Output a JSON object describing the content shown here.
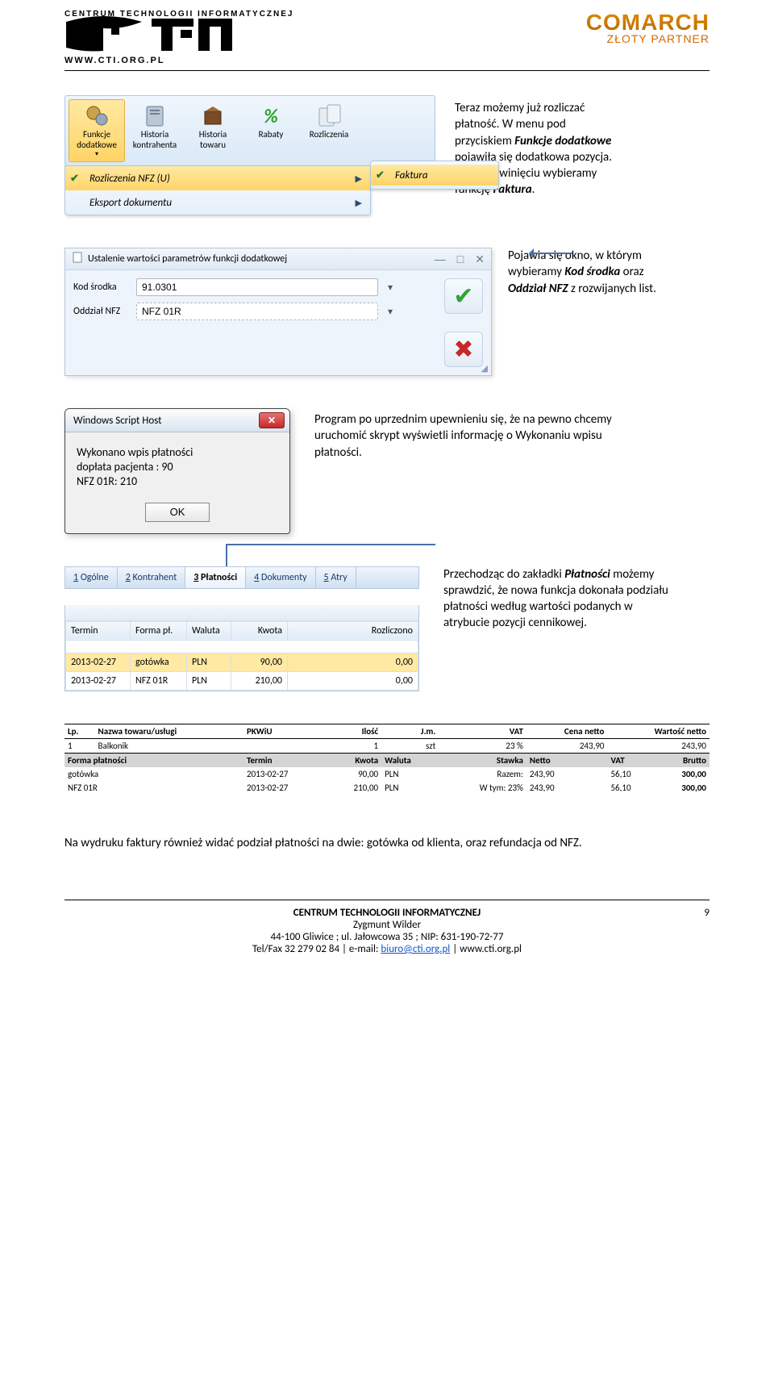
{
  "header": {
    "cti_top": "CENTRUM TECHNOLOGII INFORMATYCZNEJ",
    "cti_url": "WWW.CTI.ORG.PL",
    "comarch": "COMARCH",
    "comarch_sub": "ZŁOTY PARTNER"
  },
  "p1_l1": "Teraz możemy już rozliczać",
  "p1_l2": "płatność. W menu pod",
  "p1_l3a": "przyciskiem ",
  "p1_l3b": "Funkcje dodatkowe",
  "p1_l4": "pojawiła się dodatkowa pozycja.",
  "p1_l5": "Po jej rozwinięciu wybieramy",
  "p1_l6a": "funkcję ",
  "p1_l6b": "Faktura",
  "p1_l6c": ".",
  "ribbon": {
    "items": [
      {
        "label": "Funkcje dodatkowe"
      },
      {
        "label": "Historia kontrahenta"
      },
      {
        "label": "Historia towaru"
      },
      {
        "label": "Rabaty"
      },
      {
        "label": "Rozliczenia"
      }
    ],
    "menu": {
      "item1": "Rozliczenia NFZ (U)",
      "item2": "Eksport dokumentu",
      "sub1": "Faktura"
    }
  },
  "p2_l1": "Pojawia się okno, w którym",
  "p2_l2a": "wybieramy ",
  "p2_l2b": "Kod środka",
  "p2_l2c": " oraz",
  "p2_l3a": "Oddział NFZ",
  "p2_l3b": " z rozwijanych list.",
  "dlg": {
    "title": "Ustalenie wartości parametrów funkcji dodatkowej",
    "field1_label": "Kod środka",
    "field1_value": "91.0301",
    "field2_label": "Oddział NFZ",
    "field2_value": "NFZ 01R"
  },
  "p3_l1": "Program po uprzednim upewnieniu się, że na pewno chcemy",
  "p3_l2": "uruchomić skrypt wyświetli informację o Wykonaniu wpisu",
  "p3_l3": "płatności.",
  "wsh": {
    "title": "Windows Script Host",
    "msg_l1": "Wykonano wpis płatności",
    "msg_l2": "dopłata pacjenta : 90",
    "msg_l3": "NFZ 01R: 210",
    "ok": "OK"
  },
  "p4_l1a": "Przechodząc do zakładki ",
  "p4_l1b": "Płatności",
  "p4_l1c": " możemy",
  "p4_l2": "sprawdzić, że nowa funkcja dokonała podziału",
  "p4_l3": "płatności według wartości podanych w",
  "p4_l4": "atrybucie pozycji cennikowej.",
  "tabs": {
    "t1": "1 Ogólne",
    "t2": "2 Kontrahent",
    "t3": "3 Płatności",
    "t4": "4 Dokumenty",
    "t5": "5 Atry"
  },
  "grid": {
    "h1": "Termin",
    "h2": "Forma pł.",
    "h3": "Waluta",
    "h4": "Kwota",
    "h5": "Rozliczono",
    "r1": {
      "c1": "2013-02-27",
      "c2": "gotówka",
      "c3": "PLN",
      "c4": "90,00",
      "c5": "0,00"
    },
    "r2": {
      "c1": "2013-02-27",
      "c2": "NFZ 01R",
      "c3": "PLN",
      "c4": "210,00",
      "c5": "0,00"
    }
  },
  "print": {
    "h_lp": "Lp.",
    "h_name": "Nazwa towaru/usługi",
    "h_pkwiu": "PKWiU",
    "h_qty": "Ilość",
    "h_jm": "J.m.",
    "h_vat": "VAT",
    "h_cena": "Cena netto",
    "h_wart": "Wartość netto",
    "r1_lp": "1",
    "r1_name": "Balkonik",
    "r1_qty": "1",
    "r1_jm": "szt",
    "r1_vat": "23 %",
    "r1_cena": "243,90",
    "r1_wart": "243,90",
    "g_forma": "Forma płatności",
    "g_termin": "Termin",
    "g_kwota": "Kwota",
    "g_waluta": "Waluta",
    "g_stawka": "Stawka",
    "g_netto": "Netto",
    "g_vat": "VAT",
    "g_brutto": "Brutto",
    "p1_forma": "gotówka",
    "p1_termin": "2013-02-27",
    "p1_kwota": "90,00",
    "p1_wal": "PLN",
    "p1_lbl": "Razem:",
    "p1_netto": "243,90",
    "p1_vat": "56,10",
    "p1_brutto": "300,00",
    "p2_forma": "NFZ 01R",
    "p2_termin": "2013-02-27",
    "p2_kwota": "210,00",
    "p2_wal": "PLN",
    "p2_lbl": "W tym:",
    "p2_stawka": "23%",
    "p2_netto": "243,90",
    "p2_vat": "56,10",
    "p2_brutto": "300,00"
  },
  "p5": "Na wydruku faktury również widać podział płatności na dwie: gotówka od klienta,ẇ oraz refundacja od NFZ.",
  "p5_fixed": "Na wydruku faktury również widać podział płatności na dwie: gotówka od klienta, oraz refundacja od NFZ.",
  "footer": {
    "l1": "CENTRUM TECHNOLOGII INFORMATYCZNEJ",
    "l2": "Zygmunt Wilder",
    "l3": "44-100 Gliwice ; ul. Jałowcowa 35 ; NIP: 631-190-72-77",
    "l4a": "Tel/Fax 32 279 02 84 | e-mail: ",
    "l4_link": "biuro@cti.org.pl",
    "l4b": " | www.cti.org.pl",
    "page": "9"
  }
}
